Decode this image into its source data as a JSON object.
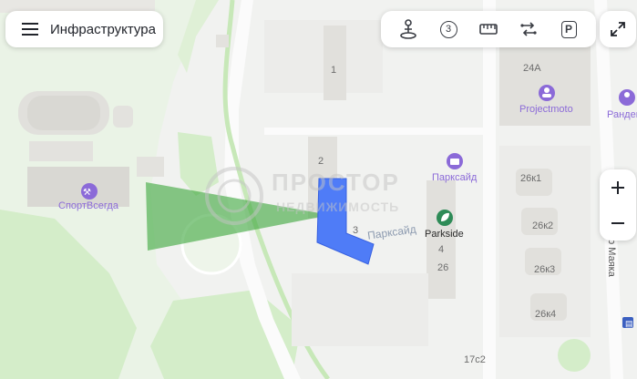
{
  "layers_button": {
    "label": "Инфраструктура",
    "icon": "menu-icon"
  },
  "toolbar": {
    "tools": [
      {
        "name": "panorama-tool",
        "icon": "person-pin-icon"
      },
      {
        "name": "metro-distance-tool",
        "icon": "number-badge-icon",
        "value": "3"
      },
      {
        "name": "ruler-tool",
        "icon": "ruler-icon"
      },
      {
        "name": "route-tool",
        "icon": "route-icon"
      },
      {
        "name": "parking-tool",
        "icon": "parking-icon",
        "value": "P"
      }
    ]
  },
  "controls": {
    "fullscreen_icon": "expand-icon",
    "zoom_in": "+",
    "zoom_out": "−"
  },
  "watermark": {
    "line1": "ПРОСТОР",
    "line2": "НЕДВИЖИМОСТЬ"
  },
  "pois": [
    {
      "label": "СпортВсегда",
      "icon": "dumbbell-icon",
      "color": "#8b6ad8"
    },
    {
      "label": "Projectmoto",
      "icon": "person-icon",
      "color": "#8b6ad8"
    },
    {
      "label": "Парксайд",
      "icon": "briefcase-icon",
      "color": "#8b6ad8"
    },
    {
      "label": "Parkside",
      "icon": "leaf-icon",
      "color": "#2e8b57"
    },
    {
      "label": "Рандеву",
      "icon": "person-icon",
      "color": "#8b6ad8"
    }
  ],
  "street_labels": [
    "Парксайд",
    "Красного Маяка"
  ],
  "building_numbers": [
    "1",
    "2",
    "3",
    "4",
    "26",
    "24А",
    "26к1",
    "26к2",
    "26к3",
    "26к4",
    "17с2"
  ],
  "colors": {
    "highlight": "#4f7cf7",
    "view_cone": "#3fa83f",
    "poi": "#8b6ad8",
    "park": "#d7efd0"
  }
}
